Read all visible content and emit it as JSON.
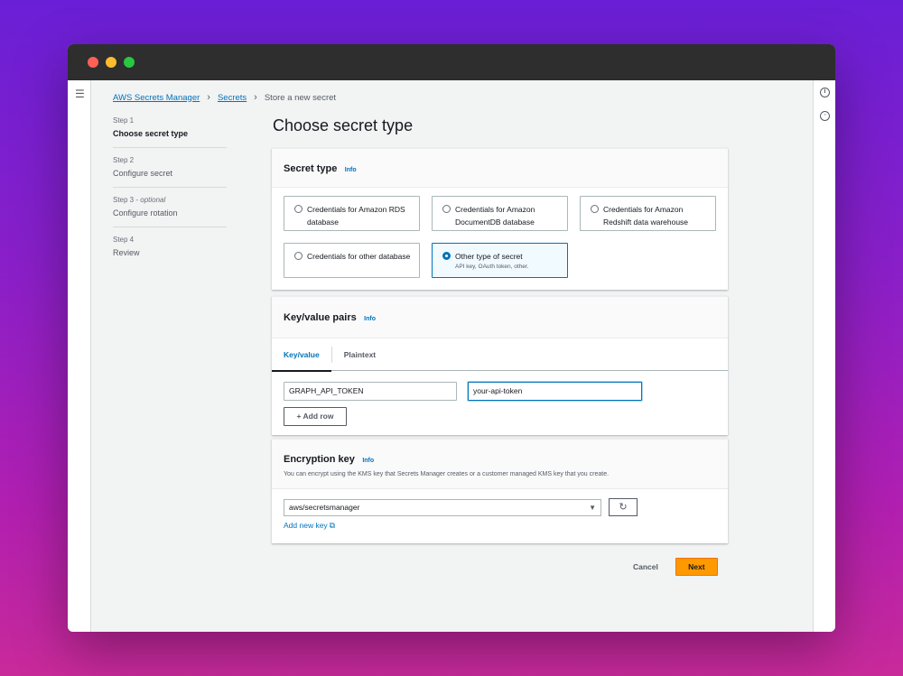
{
  "breadcrumb": {
    "items": [
      "AWS Secrets Manager",
      "Secrets"
    ],
    "current": "Store a new secret"
  },
  "steps": [
    {
      "num": "Step 1",
      "optional": "",
      "title": "Choose secret type"
    },
    {
      "num": "Step 2",
      "optional": "",
      "title": "Configure secret"
    },
    {
      "num": "Step 3",
      "optional": "optional",
      "title": "Configure rotation"
    },
    {
      "num": "Step 4",
      "optional": "",
      "title": "Review"
    }
  ],
  "page_title": "Choose secret type",
  "secret_type": {
    "title": "Secret type",
    "info": "Info",
    "options": [
      {
        "label": "Credentials for Amazon RDS database",
        "sub": ""
      },
      {
        "label": "Credentials for Amazon DocumentDB database",
        "sub": ""
      },
      {
        "label": "Credentials for Amazon Redshift data warehouse",
        "sub": ""
      },
      {
        "label": "Credentials for other database",
        "sub": ""
      },
      {
        "label": "Other type of secret",
        "sub": "API key, OAuth token, other."
      }
    ],
    "selected_index": 4
  },
  "kv": {
    "title": "Key/value pairs",
    "info": "Info",
    "tabs": [
      "Key/value",
      "Plaintext"
    ],
    "key_value": "GRAPH_API_TOKEN",
    "value_value": "your-api-token",
    "add_row": "+ Add row"
  },
  "encryption": {
    "title": "Encryption key",
    "info": "Info",
    "description": "You can encrypt using the KMS key that Secrets Manager creates or a customer managed KMS key that you create.",
    "selected": "aws/secretsmanager",
    "add_key": "Add new key"
  },
  "actions": {
    "cancel": "Cancel",
    "next": "Next"
  },
  "icons": {
    "menu": "hamburger-menu-icon",
    "info": "info-circle-icon",
    "settings": "settings-icon",
    "refresh": "refresh-icon",
    "external": "external-link-icon",
    "caret": "caret-down-icon"
  },
  "colors": {
    "link": "#0073bb",
    "primary": "#ff9900"
  }
}
